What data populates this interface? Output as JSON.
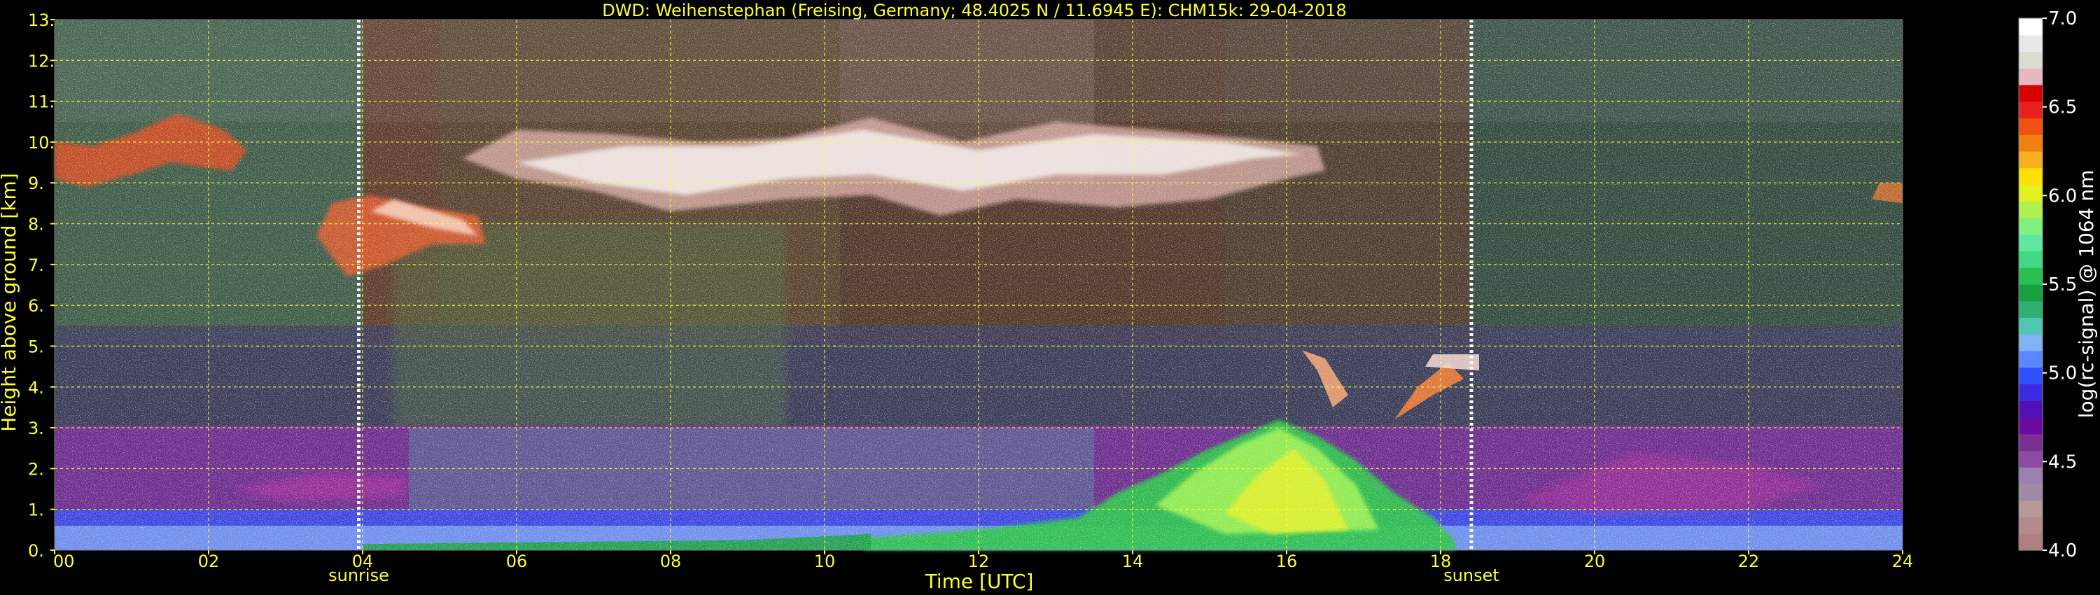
{
  "chart_data": {
    "type": "heatmap",
    "title": "DWD: Weihenstephan (Freising, Germany; 48.4025 N / 11.6945 E):    CHM15k: 29-04-2018",
    "xlabel": "Time [UTC]",
    "ylabel": "Height above ground [km]",
    "x_ticks": [
      "00",
      "02",
      "04",
      "06",
      "08",
      "10",
      "12",
      "14",
      "16",
      "18",
      "20",
      "22",
      "24"
    ],
    "y_ticks": [
      "0.",
      "1.",
      "2.",
      "3.",
      "4.",
      "5.",
      "6.",
      "7.",
      "8.",
      "9.",
      "10.",
      "11.",
      "12.",
      "13."
    ],
    "xlim": [
      0,
      24
    ],
    "ylim": [
      0,
      13
    ],
    "grid": true,
    "events": [
      {
        "label": "sunrise",
        "time": 3.95
      },
      {
        "label": "sunset",
        "time": 18.4
      }
    ],
    "colorbar": {
      "label": "log(rc-signal) @ 1064 nm",
      "ticks": [
        "4.0",
        "4.5",
        "5.0",
        "5.5",
        "6.0",
        "6.5",
        "7.0"
      ],
      "range": [
        4.0,
        7.0
      ],
      "colors": [
        "#b08080",
        "#b48a8a",
        "#b89898",
        "#a08aa6",
        "#9c80b0",
        "#8c4aa0",
        "#7a3090",
        "#6a0aa0",
        "#5010b8",
        "#3a2ae0",
        "#3050ff",
        "#5a86ff",
        "#7fb4f0",
        "#50c8b0",
        "#30b070",
        "#18a040",
        "#28c050",
        "#40d880",
        "#60e8a0",
        "#80f080",
        "#b0f050",
        "#e0f020",
        "#ffe000",
        "#f8b020",
        "#f08010",
        "#f05010",
        "#e82020",
        "#d80000",
        "#e8b8c0",
        "#dcdcd0",
        "#e8e8e8",
        "#ffffff"
      ]
    },
    "features": [
      {
        "kind": "boundary_layer_aerosol",
        "time_start": 0,
        "time_end": 24,
        "height_top_km": 3.0
      },
      {
        "kind": "convective_mixing_layer",
        "time_start": 13.5,
        "time_end": 17.5,
        "height_top_km": 3.2
      },
      {
        "kind": "cirrus_cloud",
        "time_start": 0,
        "time_end": 2.5,
        "height_range_km": [
          9.0,
          10.6
        ]
      },
      {
        "kind": "cirrus_cloud",
        "time_start": 3.5,
        "time_end": 5.5,
        "height_range_km": [
          7.5,
          8.8
        ]
      },
      {
        "kind": "cirrus_cloud",
        "time_start": 5.3,
        "time_end": 16.5,
        "height_range_km": [
          8.5,
          10.5
        ]
      },
      {
        "kind": "cloud_fragments",
        "time_start": 16.0,
        "time_end": 18.5,
        "height_range_km": [
          3.2,
          5.0
        ]
      }
    ]
  }
}
